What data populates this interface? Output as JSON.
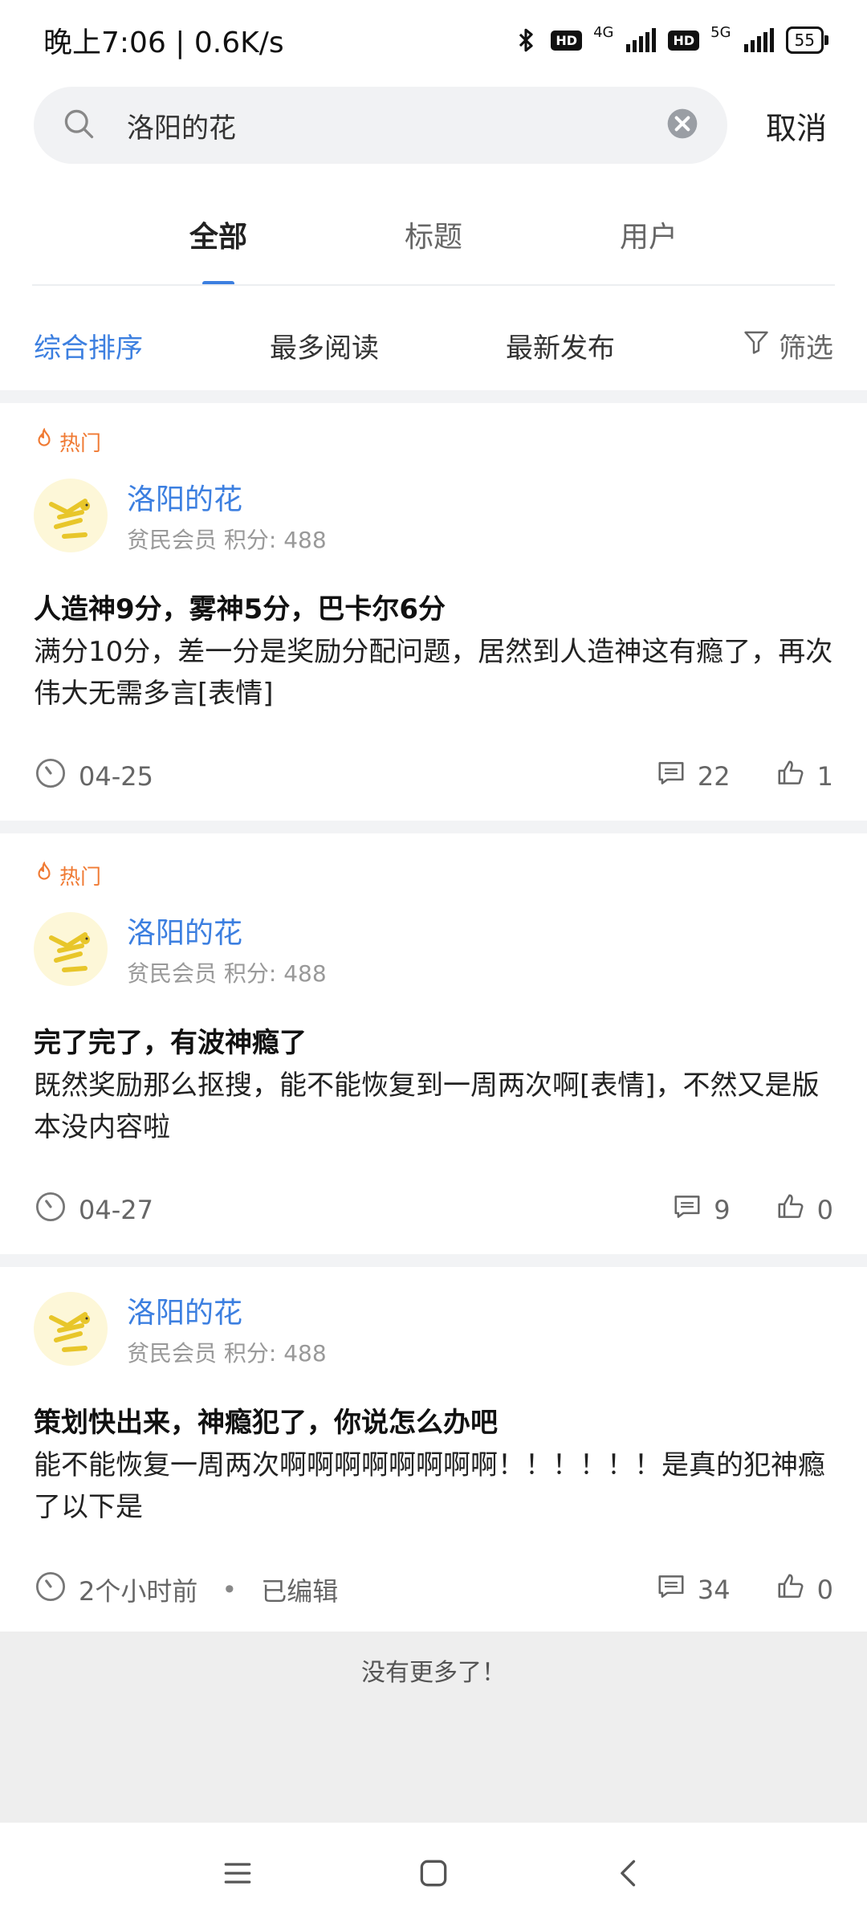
{
  "status": {
    "time_speed": "晚上7:06 | 0.6K/s",
    "hd": "HD",
    "net1": "4G",
    "net2": "5G",
    "battery": "55"
  },
  "search": {
    "query": "洛阳的花",
    "cancel_label": "取消",
    "icons": {
      "search": "search-icon",
      "clear": "clear-icon"
    }
  },
  "tabs": [
    {
      "label": "全部",
      "active": true
    },
    {
      "label": "标题",
      "active": false
    },
    {
      "label": "用户",
      "active": false
    }
  ],
  "sort": {
    "items": [
      "综合排序",
      "最多阅读",
      "最新发布"
    ],
    "active_index": 0,
    "filter_label": "筛选"
  },
  "posts": [
    {
      "hot_label": "热门",
      "user": "洛阳的花",
      "meta": "贫民会员  积分: 488",
      "title": "人造神9分，雾神5分，巴卡尔6分",
      "body": "满分10分，差一分是奖励分配问题，居然到人造神这有瘾了，再次伟大无需多言[表情]",
      "date": "04-25",
      "comments": "22",
      "likes": "1"
    },
    {
      "hot_label": "热门",
      "user": "洛阳的花",
      "meta": "贫民会员  积分: 488",
      "title": "完了完了，有波神瘾了",
      "body": "既然奖励那么抠搜，能不能恢复到一周两次啊[表情]，不然又是版本没内容啦",
      "date": "04-27",
      "comments": "9",
      "likes": "0"
    },
    {
      "user": "洛阳的花",
      "meta": "贫民会员  积分: 488",
      "title": "策划快出来，神瘾犯了，你说怎么办吧",
      "body": " 能不能恢复一周两次啊啊啊啊啊啊啊啊！！！！！！是真的犯神瘾了以下是",
      "date": "2个小时前",
      "edited": "已编辑",
      "comments": "34",
      "likes": "0"
    }
  ],
  "no_more": "没有更多了！",
  "colors": {
    "accent": "#3c7fe0",
    "hot": "#f07a33"
  }
}
